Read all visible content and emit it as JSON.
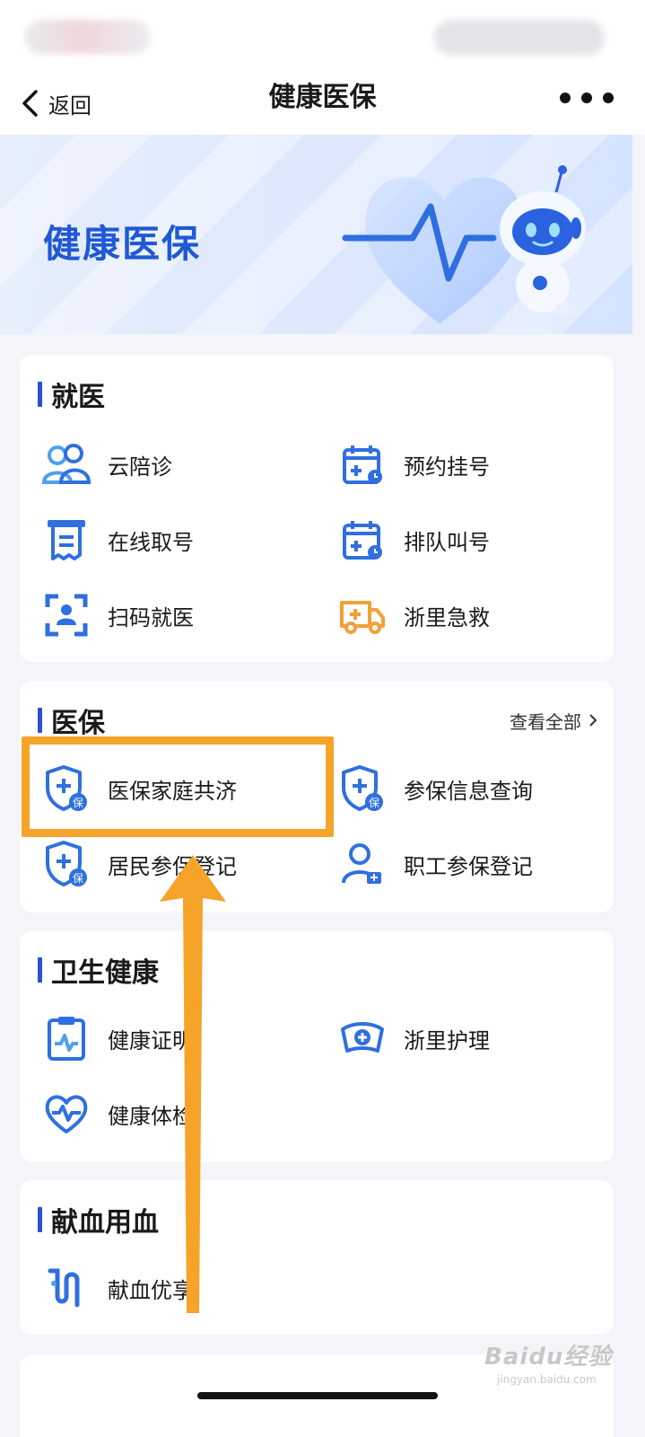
{
  "nav": {
    "back_label": "返回",
    "title": "健康医保"
  },
  "banner": {
    "title": "健康医保"
  },
  "sections": {
    "jiuyi": {
      "title": "就医",
      "items": [
        "云陪诊",
        "预约挂号",
        "在线取号",
        "排队叫号",
        "扫码就医",
        "浙里急救"
      ]
    },
    "yibao": {
      "title": "医保",
      "view_all": "查看全部",
      "items": [
        "医保家庭共济",
        "参保信息查询",
        "居民参保登记",
        "职工参保登记"
      ]
    },
    "weisheng": {
      "title": "卫生健康",
      "items": [
        "健康证明",
        "浙里护理",
        "健康体检"
      ]
    },
    "xianxue": {
      "title": "献血用血",
      "items": [
        "献血优享"
      ]
    }
  },
  "watermark": {
    "main": "Baidu经验",
    "sub": "jingyan.baidu.com"
  },
  "colors": {
    "accent": "#2a4fd6",
    "icon_blue": "#2f6fe0",
    "icon_orange": "#f2a03a",
    "highlight": "#f6a32a"
  }
}
